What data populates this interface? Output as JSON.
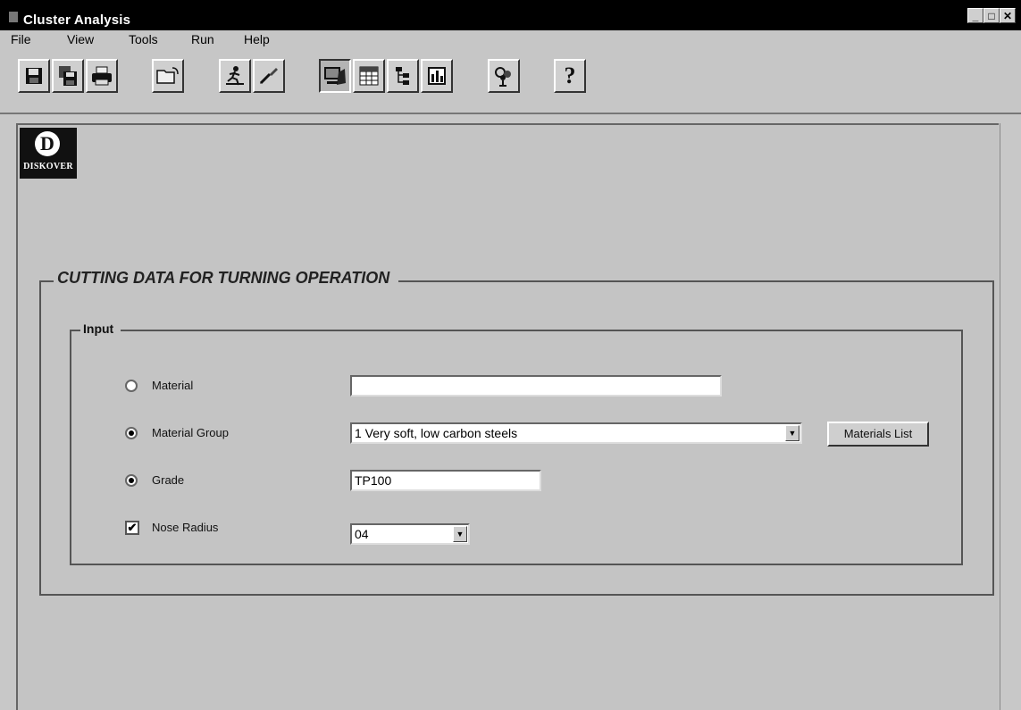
{
  "window": {
    "title": "Cluster Analysis",
    "controls": [
      "_",
      "□",
      "✕"
    ]
  },
  "menu": [
    "File",
    "View",
    "Tools",
    "Run",
    "Help"
  ],
  "toolbar": {
    "buttons": [
      {
        "icon": "save-icon"
      },
      {
        "icon": "save-all-icon"
      },
      {
        "icon": "print-icon"
      },
      {
        "icon": "open-folder-icon"
      },
      {
        "icon": "run-icon"
      },
      {
        "icon": "brush-icon"
      },
      {
        "icon": "analysis-icon"
      },
      {
        "icon": "spreadsheet-icon"
      },
      {
        "icon": "tree-icon"
      },
      {
        "icon": "chart-icon"
      },
      {
        "icon": "cluster-icon"
      },
      {
        "icon": "help-icon",
        "glyph": "?"
      }
    ]
  },
  "logo": {
    "text": "DISKOVER",
    "mark": "D"
  },
  "form": {
    "title": "CUTTING DATA FOR TURNING OPERATION",
    "input_group": "Input",
    "material": {
      "label": "Material",
      "value": "",
      "selected": false
    },
    "material_group": {
      "label": "Material Group",
      "value": "1 Very soft, low carbon steels",
      "selected": true
    },
    "materials_list_button": "Materials List",
    "grade": {
      "label": "Grade",
      "value": "TP100",
      "selected": true
    },
    "nose_radius": {
      "label": "Nose Radius",
      "value": "04",
      "checked": true,
      "check_mark": "✔"
    }
  },
  "colors": {
    "titlebar": "#000000",
    "face": "#c4c4c4"
  }
}
